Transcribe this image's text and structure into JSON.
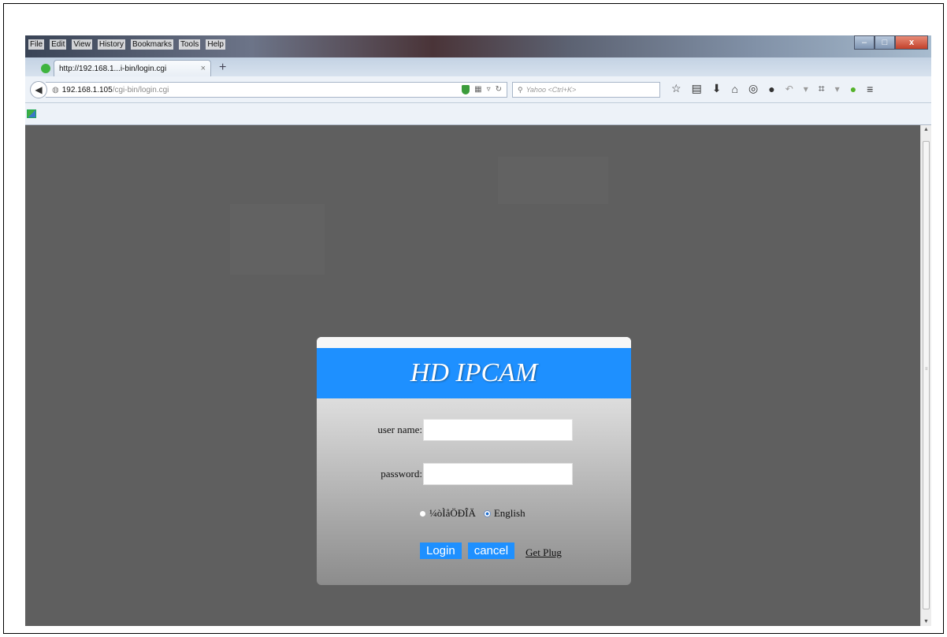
{
  "browser": {
    "menu": [
      "File",
      "Edit",
      "View",
      "History",
      "Bookmarks",
      "Tools",
      "Help"
    ],
    "tab_title": "http://192.168.1...i-bin/login.cgi",
    "tab_close": "×",
    "new_tab": "+",
    "url_host": "192.168.1.105",
    "url_path": "/cgi-bin/login.cgi",
    "search_placeholder": "Yahoo <Ctrl+K>",
    "window_controls": {
      "minimize": "–",
      "maximize": "□",
      "close": "x"
    }
  },
  "login": {
    "title": "HD IPCAM",
    "username_label": "user name:",
    "username_value": "",
    "password_label": "password:",
    "password_value": "",
    "languages": [
      {
        "label": "¼òÌåÖÐÎÄ",
        "selected": false
      },
      {
        "label": "English",
        "selected": true
      }
    ],
    "login_button": "Login",
    "cancel_button": "cancel",
    "get_plug_link": "Get Plug"
  },
  "colors": {
    "accent": "#1e90ff",
    "page_background": "#5f5f5f"
  }
}
